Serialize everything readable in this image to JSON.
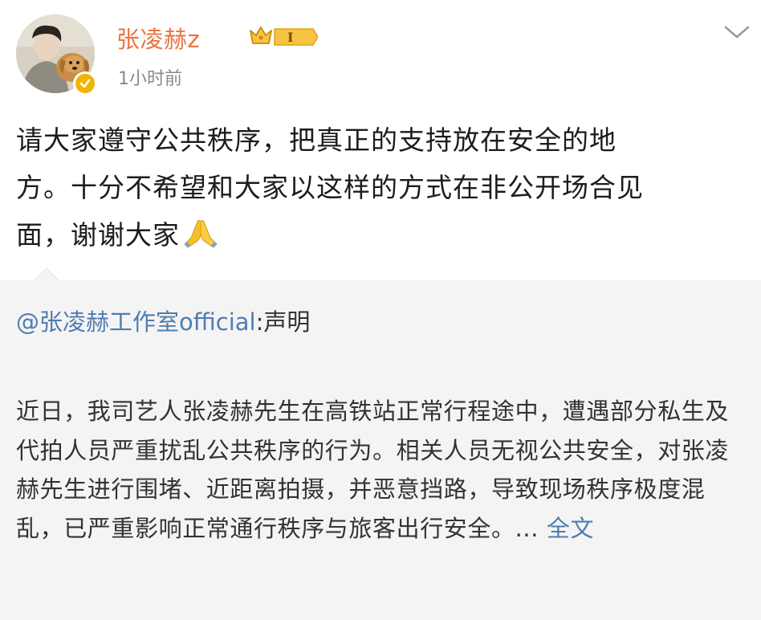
{
  "post": {
    "username": "张凌赫z",
    "vip_level": "I",
    "timestamp": "1小时前",
    "text_line1": "请大家遵守公共秩序，把真正的支持放在安全的地",
    "text_line2": "方。十分不希望和大家以这样的方式在非公开场合见",
    "text_line3": "面，谢谢大家",
    "emoji": "pray-emoji"
  },
  "repost": {
    "author": "@张凌赫工作室official",
    "separator": ":",
    "title": "声明",
    "text": "近日，我司艺人张凌赫先生在高铁站正常行程途中，遭遇部分私生及代拍人员严重扰乱公共秩序的行为。相关人员无视公共安全，对张凌赫先生进行围堵、近距离拍摄，并恶意挡路，导致现场秩序极度混乱，已严重影响正常通行秩序与旅客出行安全。",
    "ellipsis": "... ",
    "full_text_link": "全文"
  },
  "colors": {
    "username": "#eb7340",
    "link": "#507daf",
    "repost_bg": "#f4f4f4",
    "verify_badge": "#f2b400",
    "timestamp": "#8a8a8a"
  }
}
